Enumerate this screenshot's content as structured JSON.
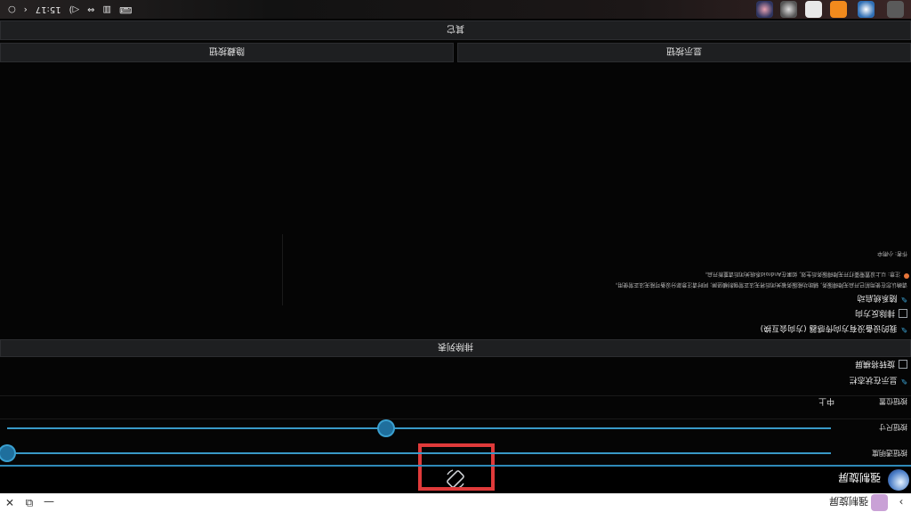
{
  "window": {
    "title": "强制旋屏",
    "controls": {
      "minimize": "—",
      "restore": "⧉",
      "close": "✕"
    },
    "expand": "›"
  },
  "app_header": {
    "name": "强制旋屏"
  },
  "settings": {
    "rows": [
      {
        "label": "按钮透明度"
      },
      {
        "label": "按钮尺寸"
      },
      {
        "label": "按钮位置",
        "value": "中上"
      }
    ],
    "sliders": {
      "opacity": 0.0,
      "size": 0.46
    },
    "show_in_statusbar": {
      "label": "显示在状态栏"
    },
    "rotate_to_landscape": {
      "label": "旋转将横屏"
    },
    "excluded_button": "排除列表",
    "sensor_rotate": {
      "label": "我的设备没有方向传感器 (方向会互换)"
    },
    "exclude_direction": {
      "label": "排除反方向"
    },
    "boot_start": {
      "label": "随系统启动"
    },
    "hint_line1": "请确认您在使用前已开启无障碍服务, 辅助功能服务被关闭后将无法正常强制横竖屏; 同时请注意部分设备可能无法正常使用。",
    "hint_line2": "注意: 以上设置需要打开无障碍服务后生效, 如果在Android系统关闭后请重新开启。",
    "author": "作者: 小雨伞"
  },
  "buttons": {
    "show": "显示按钮",
    "hide": "隐藏按钮",
    "other": "其它"
  },
  "taskbar": {
    "time": "15:17",
    "icons": [
      "⌨",
      "▥",
      "⇔",
      "◁)"
    ]
  },
  "colors": {
    "accent": "#3899c7",
    "highlight": "#e03a3a"
  }
}
